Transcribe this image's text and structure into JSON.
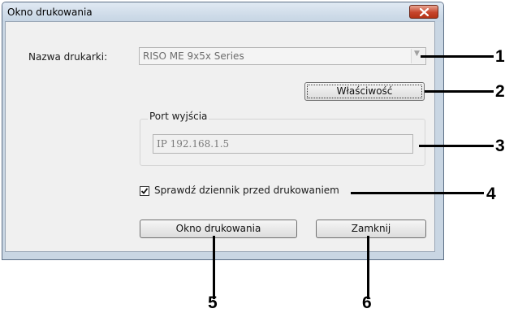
{
  "window": {
    "title": "Okno drukowania",
    "close_icon": "close-icon"
  },
  "printer": {
    "label": "Nazwa drukarki:",
    "selected_value": "RISO ME 9x5x Series"
  },
  "buttons": {
    "properties_label": "Właściwość",
    "print_window_label": "Okno drukowania",
    "close_label": "Zamknij"
  },
  "output_port": {
    "group_title": "Port wyjścia",
    "value": "IP 192.168.1.5"
  },
  "check_log": {
    "label": "Sprawdź dziennik przed drukowaniem",
    "checked": true
  },
  "callouts": [
    "1",
    "2",
    "3",
    "4",
    "5",
    "6"
  ]
}
